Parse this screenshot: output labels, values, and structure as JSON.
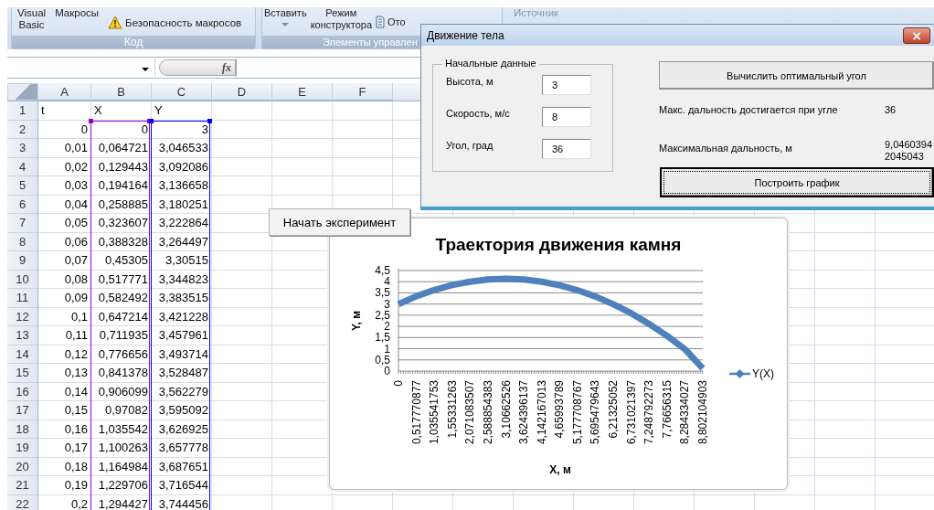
{
  "ribbon": {
    "groups": [
      {
        "label": "Код",
        "items": [
          {
            "kind": "large",
            "label": "Visual Basic"
          },
          {
            "kind": "large",
            "label": "Макросы"
          },
          {
            "kind": "warning",
            "label": "Безопасность макросов"
          }
        ]
      },
      {
        "label": "Элементы управлен",
        "items": [
          {
            "kind": "dropdown",
            "label": "Вставить"
          },
          {
            "kind": "large",
            "label": "Режим конструктора"
          },
          {
            "kind": "properties",
            "label": "Ото"
          }
        ]
      },
      {
        "items": [
          {
            "kind": "large",
            "label": "Источник"
          }
        ]
      }
    ]
  },
  "formula_bar": {
    "function_label": "fx"
  },
  "sheet": {
    "columns": [
      {
        "label": "A"
      },
      {
        "label": "B",
        "color": "#9900cc"
      },
      {
        "label": "C",
        "color": "#0000ff"
      },
      {
        "label": "D"
      },
      {
        "label": "E"
      },
      {
        "label": "F"
      }
    ],
    "rows": [
      {
        "number": "1",
        "kind": "text",
        "cells": [
          "t",
          "X",
          "Y"
        ]
      },
      {
        "number": "2",
        "kind": "number",
        "cells": [
          "0",
          "0",
          "3"
        ]
      },
      {
        "number": "3",
        "kind": "number",
        "cells": [
          "0,01",
          "0,064721",
          "3,046533"
        ]
      },
      {
        "number": "4",
        "kind": "number",
        "cells": [
          "0,02",
          "0,129443",
          "3,092086"
        ]
      },
      {
        "number": "5",
        "kind": "number",
        "cells": [
          "0,03",
          "0,194164",
          "3,136658"
        ]
      },
      {
        "number": "6",
        "kind": "number",
        "cells": [
          "0,04",
          "0,258885",
          "3,180251"
        ]
      },
      {
        "number": "7",
        "kind": "number",
        "cells": [
          "0,05",
          "0,323607",
          "3,222864"
        ]
      },
      {
        "number": "8",
        "kind": "number",
        "cells": [
          "0,06",
          "0,388328",
          "3,264497"
        ]
      },
      {
        "number": "9",
        "kind": "number",
        "cells": [
          "0,07",
          "0,45305",
          "3,30515"
        ]
      },
      {
        "number": "10",
        "kind": "number",
        "cells": [
          "0,08",
          "0,517771",
          "3,344823"
        ]
      },
      {
        "number": "11",
        "kind": "number",
        "cells": [
          "0,09",
          "0,582492",
          "3,383515"
        ]
      },
      {
        "number": "12",
        "kind": "number",
        "cells": [
          "0,1",
          "0,647214",
          "3,421228"
        ]
      },
      {
        "number": "13",
        "kind": "number",
        "cells": [
          "0,11",
          "0,711935",
          "3,457961"
        ]
      },
      {
        "number": "14",
        "kind": "number",
        "cells": [
          "0,12",
          "0,776656",
          "3,493714"
        ]
      },
      {
        "number": "15",
        "kind": "number",
        "cells": [
          "0,13",
          "0,841378",
          "3,528487"
        ]
      },
      {
        "number": "16",
        "kind": "number",
        "cells": [
          "0,14",
          "0,906099",
          "3,562279"
        ]
      },
      {
        "number": "17",
        "kind": "number",
        "cells": [
          "0,15",
          "0,97082",
          "3,595092"
        ]
      },
      {
        "number": "18",
        "kind": "number",
        "cells": [
          "0,16",
          "1,035542",
          "3,626925"
        ]
      },
      {
        "number": "19",
        "kind": "number",
        "cells": [
          "0,17",
          "1,100263",
          "3,657778"
        ]
      },
      {
        "number": "20",
        "kind": "number",
        "cells": [
          "0,18",
          "1,164984",
          "3,687651"
        ]
      },
      {
        "number": "21",
        "kind": "number",
        "cells": [
          "0,19",
          "1,229706",
          "3,716544"
        ]
      },
      {
        "number": "22",
        "kind": "number",
        "cells": [
          "0,2",
          "1,294427",
          "3,744456"
        ]
      }
    ]
  },
  "start_button": {
    "label": "Начать эксперимент"
  },
  "dialog": {
    "title": "Движение тела",
    "close_label": "×",
    "group": {
      "title": "Начальные данные",
      "fields": [
        {
          "label": "Высота, м",
          "value": "3"
        },
        {
          "label": "Скорость, м/с",
          "value": "8"
        },
        {
          "label": "Угол, град",
          "value": "36"
        }
      ]
    },
    "compute_button": {
      "label": "Вычислить оптимальный угол"
    },
    "results": [
      {
        "label": "Макс. дальность достигается при угле",
        "value": "36"
      },
      {
        "label": "Максимальная дальность, м",
        "value": "9,04603942045043"
      }
    ],
    "plot_button": {
      "label": "Построить график",
      "focused": true
    }
  },
  "chart": {
    "chart_data": {
      "type": "line",
      "title": "Траектория движения камня",
      "xlabel": "X, м",
      "ylabel": "Y, м",
      "categories": [
        "0",
        "0,517770877",
        "1,035541753",
        "1,55331263",
        "2,071083507",
        "2,588854383",
        "3,10662526",
        "3,624396137",
        "4,142167013",
        "4,65993789",
        "5,177708767",
        "5,695479643",
        "6,21325052",
        "6,731021397",
        "7,248792273",
        "7,76656315",
        "8,284334027",
        "8,802104903"
      ],
      "series": [
        {
          "name": "Y(X)",
          "color": "#4f81bd",
          "values": [
            3,
            3.35,
            3.63,
            3.85,
            4,
            4.1,
            4.13,
            4.1,
            4,
            3.84,
            3.62,
            3.34,
            2.99,
            2.59,
            2.11,
            1.58,
            0.98,
            0.12
          ]
        }
      ],
      "ylim": [
        0,
        4.5
      ],
      "grid": true,
      "yticks": [
        {
          "value": 0,
          "label": "0"
        },
        {
          "value": 0.5,
          "label": "0,5"
        },
        {
          "value": 1,
          "label": "1"
        },
        {
          "value": 1.5,
          "label": "1,5"
        },
        {
          "value": 2,
          "label": "2"
        },
        {
          "value": 2.5,
          "label": "2,5"
        },
        {
          "value": 3,
          "label": "3"
        },
        {
          "value": 3.5,
          "label": "3,5"
        },
        {
          "value": 4,
          "label": "4"
        },
        {
          "value": 4.5,
          "label": "4,5"
        }
      ]
    }
  }
}
